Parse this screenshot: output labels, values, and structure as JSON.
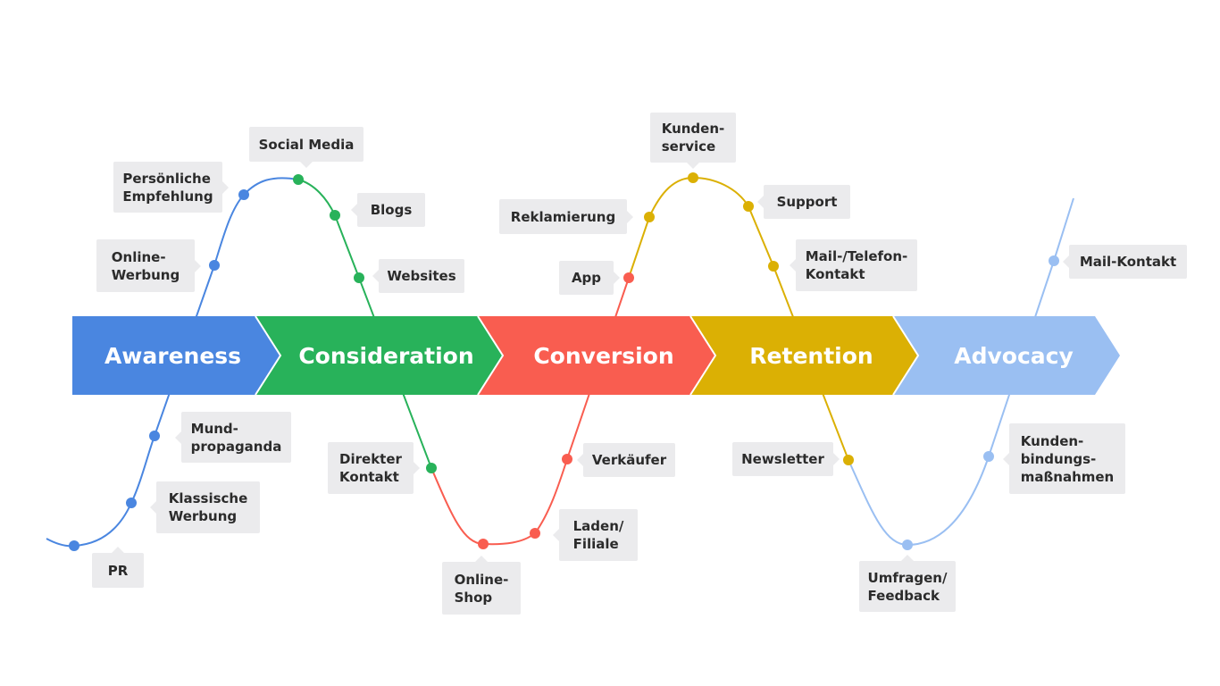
{
  "stages": [
    {
      "label": "Awareness",
      "color": "#4a86e0"
    },
    {
      "label": "Consideration",
      "color": "#28b25a"
    },
    {
      "label": "Conversion",
      "color": "#f95d50"
    },
    {
      "label": "Retention",
      "color": "#dbb004"
    },
    {
      "label": "Advocacy",
      "color": "#9abff2"
    }
  ],
  "touchpoints": [
    {
      "label": "PR",
      "stage": 0
    },
    {
      "label": "Klassische\nWerbung",
      "stage": 0
    },
    {
      "label": "Mund-\npropaganda",
      "stage": 0
    },
    {
      "label": "Online-\nWerbung",
      "stage": 0
    },
    {
      "label": "Persönliche\nEmpfehlung",
      "stage": 0
    },
    {
      "label": "Social Media",
      "stage": 1
    },
    {
      "label": "Blogs",
      "stage": 1
    },
    {
      "label": "Websites",
      "stage": 1
    },
    {
      "label": "Direkter\nKontakt",
      "stage": 1
    },
    {
      "label": "Online-\nShop",
      "stage": 2
    },
    {
      "label": "Laden/\nFiliale",
      "stage": 2
    },
    {
      "label": "Verkäufer",
      "stage": 2
    },
    {
      "label": "App",
      "stage": 2
    },
    {
      "label": "Reklamierung",
      "stage": 3
    },
    {
      "label": "Kunden-\nservice",
      "stage": 3
    },
    {
      "label": "Support",
      "stage": 3
    },
    {
      "label": "Mail-/Telefon-\nKontakt",
      "stage": 3
    },
    {
      "label": "Newsletter",
      "stage": 3
    },
    {
      "label": "Umfragen/\nFeedback",
      "stage": 4
    },
    {
      "label": "Kunden-\nbindungs-\nmaßnahmen",
      "stage": 4
    },
    {
      "label": "Mail-Kontakt",
      "stage": 4
    }
  ]
}
